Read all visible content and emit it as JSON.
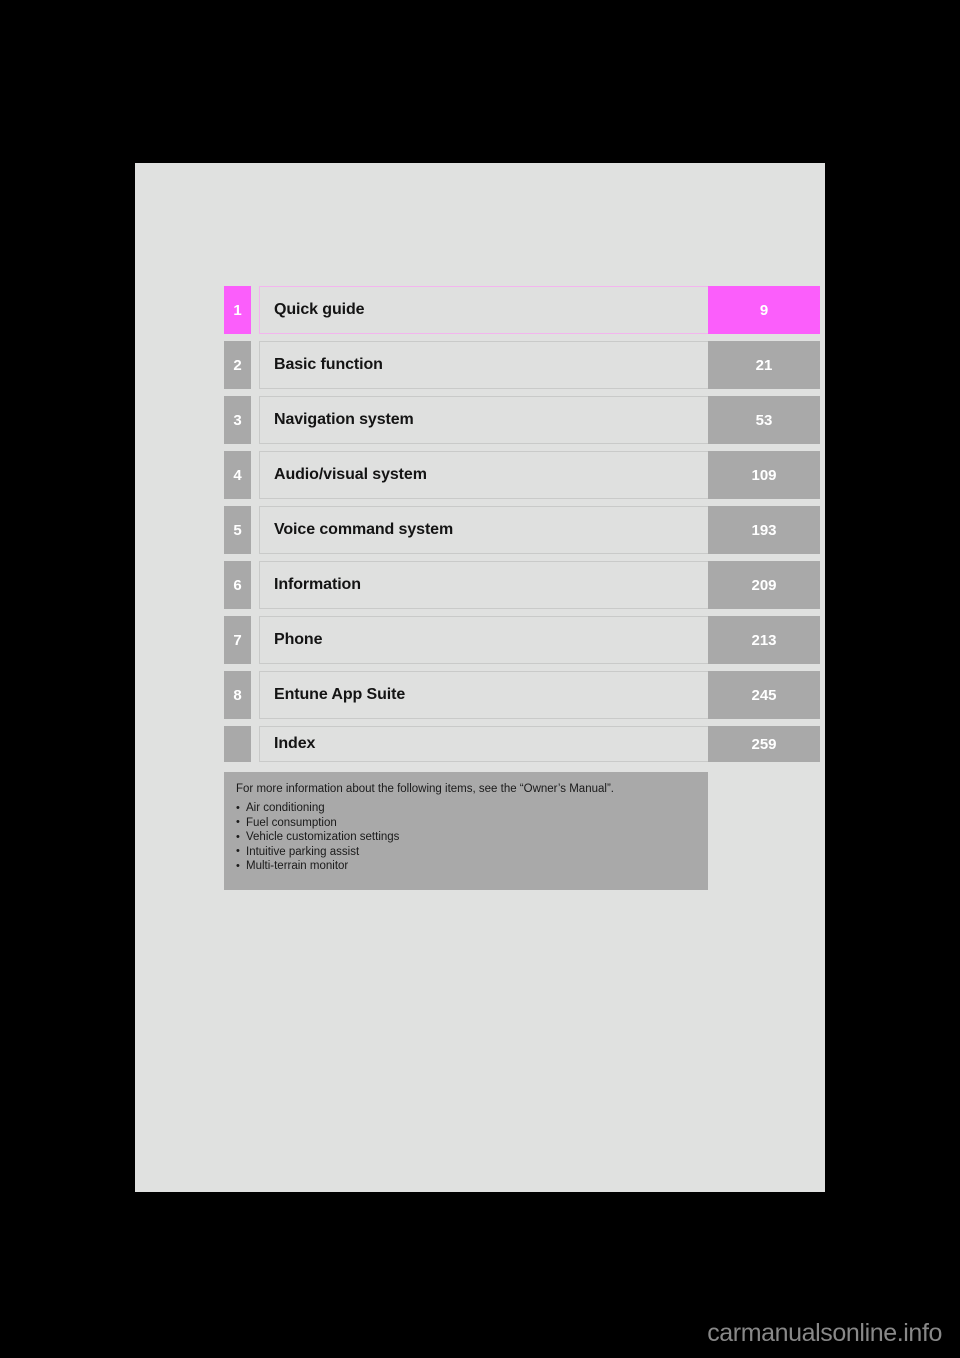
{
  "document": {
    "type": "table-of-contents",
    "watermark": "carmanualsonline.info"
  },
  "colors": {
    "page_background": "#e0e1e0",
    "row_gray": "#a9a9a9",
    "label_cell": "#dfe0df",
    "highlight_magenta": "#fb5efb",
    "highlight_border": "#f3b5ee",
    "canvas_black": "#000000"
  },
  "toc": {
    "rows": [
      {
        "number": "1",
        "title": "Quick guide",
        "page": "9",
        "highlight": true
      },
      {
        "number": "2",
        "title": "Basic function",
        "page": "21",
        "highlight": false
      },
      {
        "number": "3",
        "title": "Navigation system",
        "page": "53",
        "highlight": false
      },
      {
        "number": "4",
        "title": "Audio/visual system",
        "page": "109",
        "highlight": false
      },
      {
        "number": "5",
        "title": "Voice command system",
        "page": "193",
        "highlight": false
      },
      {
        "number": "6",
        "title": "Information",
        "page": "209",
        "highlight": false
      },
      {
        "number": "7",
        "title": "Phone",
        "page": "213",
        "highlight": false
      },
      {
        "number": "8",
        "title": "Entune App Suite",
        "page": "245",
        "highlight": false
      },
      {
        "number": "",
        "title": "Index",
        "page": "259",
        "highlight": false
      }
    ]
  },
  "note": {
    "heading": "For more information about the following items, see the “Owner’s Manual”.",
    "items": [
      "Air conditioning",
      "Fuel consumption",
      "Vehicle customization settings",
      "Intuitive parking assist",
      "Multi-terrain monitor"
    ]
  }
}
